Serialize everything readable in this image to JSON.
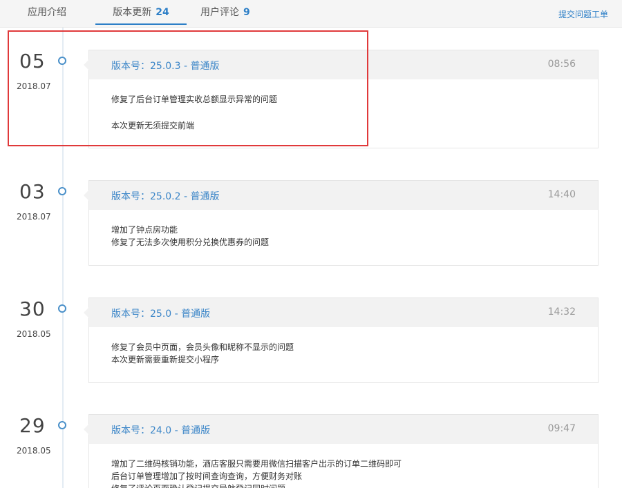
{
  "tabs": [
    {
      "label": "应用介绍",
      "count": ""
    },
    {
      "label": "版本更新",
      "count": "24"
    },
    {
      "label": "用户评论",
      "count": "9"
    }
  ],
  "submit_link": "提交问题工单",
  "entries": [
    {
      "day": "05",
      "month": "2018.07",
      "version": "版本号：25.0.3 - 普通版",
      "time": "08:56",
      "notes": [
        "修复了后台订单管理实收总额显示异常的问题",
        "本次更新无须提交前端"
      ]
    },
    {
      "day": "03",
      "month": "2018.07",
      "version": "版本号：25.0.2 - 普通版",
      "time": "14:40",
      "notes": [
        "增加了钟点房功能",
        "修复了无法多次使用积分兑换优惠券的问题"
      ]
    },
    {
      "day": "30",
      "month": "2018.05",
      "version": "版本号：25.0 - 普通版",
      "time": "14:32",
      "notes": [
        "修复了会员中页面，会员头像和昵称不显示的问题",
        "本次更新需要重新提交小程序"
      ]
    },
    {
      "day": "29",
      "month": "2018.05",
      "version": "版本号：24.0 - 普通版",
      "time": "09:47",
      "notes": [
        "增加了二维码核销功能，酒店客服只需要用微信扫描客户出示的订单二维码即可",
        "后台订单管理增加了按时间查询查询，方便财务对账",
        "修复了评论页面确认登记提交导航登记同时问题"
      ]
    }
  ],
  "colors": {
    "accent": "#2d7fc7",
    "highlight": "#e0393a",
    "timeline_dot": "#4a90c9"
  }
}
